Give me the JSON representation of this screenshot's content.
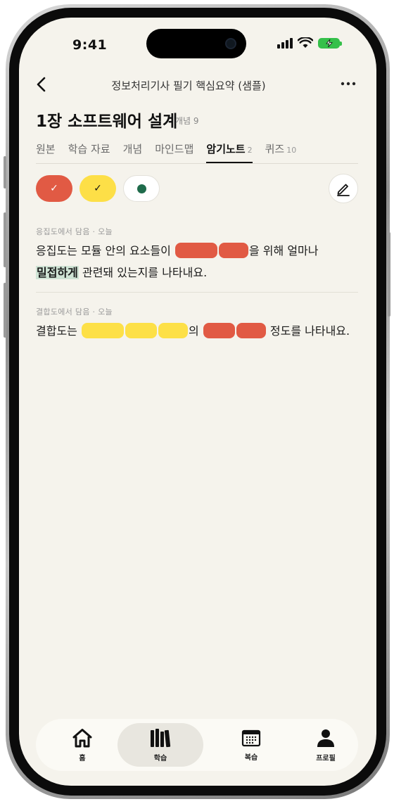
{
  "status_bar": {
    "time": "9:41"
  },
  "header": {
    "title": "정보처리기사 필기 핵심요약 (샘플)",
    "chapter_title": "1장 소프트웨어 설계",
    "concept_label": "개념 9"
  },
  "tabs": [
    {
      "label": "원본",
      "count": ""
    },
    {
      "label": "학습 자료",
      "count": ""
    },
    {
      "label": "개념",
      "count": ""
    },
    {
      "label": "마인드맵",
      "count": ""
    },
    {
      "label": "암기노트",
      "count": "2",
      "active": true
    },
    {
      "label": "퀴즈",
      "count": "10"
    }
  ],
  "filters": {
    "red_check": "✓",
    "yellow_check": "✓"
  },
  "colors": {
    "red": "#e15a44",
    "yellow": "#fddf47",
    "green": "#1f6b4b",
    "background": "#f5f3ec"
  },
  "notes": [
    {
      "meta": "응집도에서 담음 · 오늘",
      "text_a": "응집도는 모듈 안의 요소들이",
      "text_b": "을 위해 얼마나",
      "highlight": "밀접하게",
      "text_c": " 관련돼 있는지를 나타내요."
    },
    {
      "meta": "결합도에서 담음 · 오늘",
      "text_a": "결합도는",
      "text_b": "의",
      "text_c": " 정도를 나타내요."
    }
  ],
  "bottom_nav": [
    {
      "label": "홈",
      "icon": "home-icon"
    },
    {
      "label": "학습",
      "icon": "books-icon",
      "active": true
    },
    {
      "label": "복습",
      "icon": "calendar-icon"
    },
    {
      "label": "프로필",
      "icon": "person-icon"
    }
  ]
}
